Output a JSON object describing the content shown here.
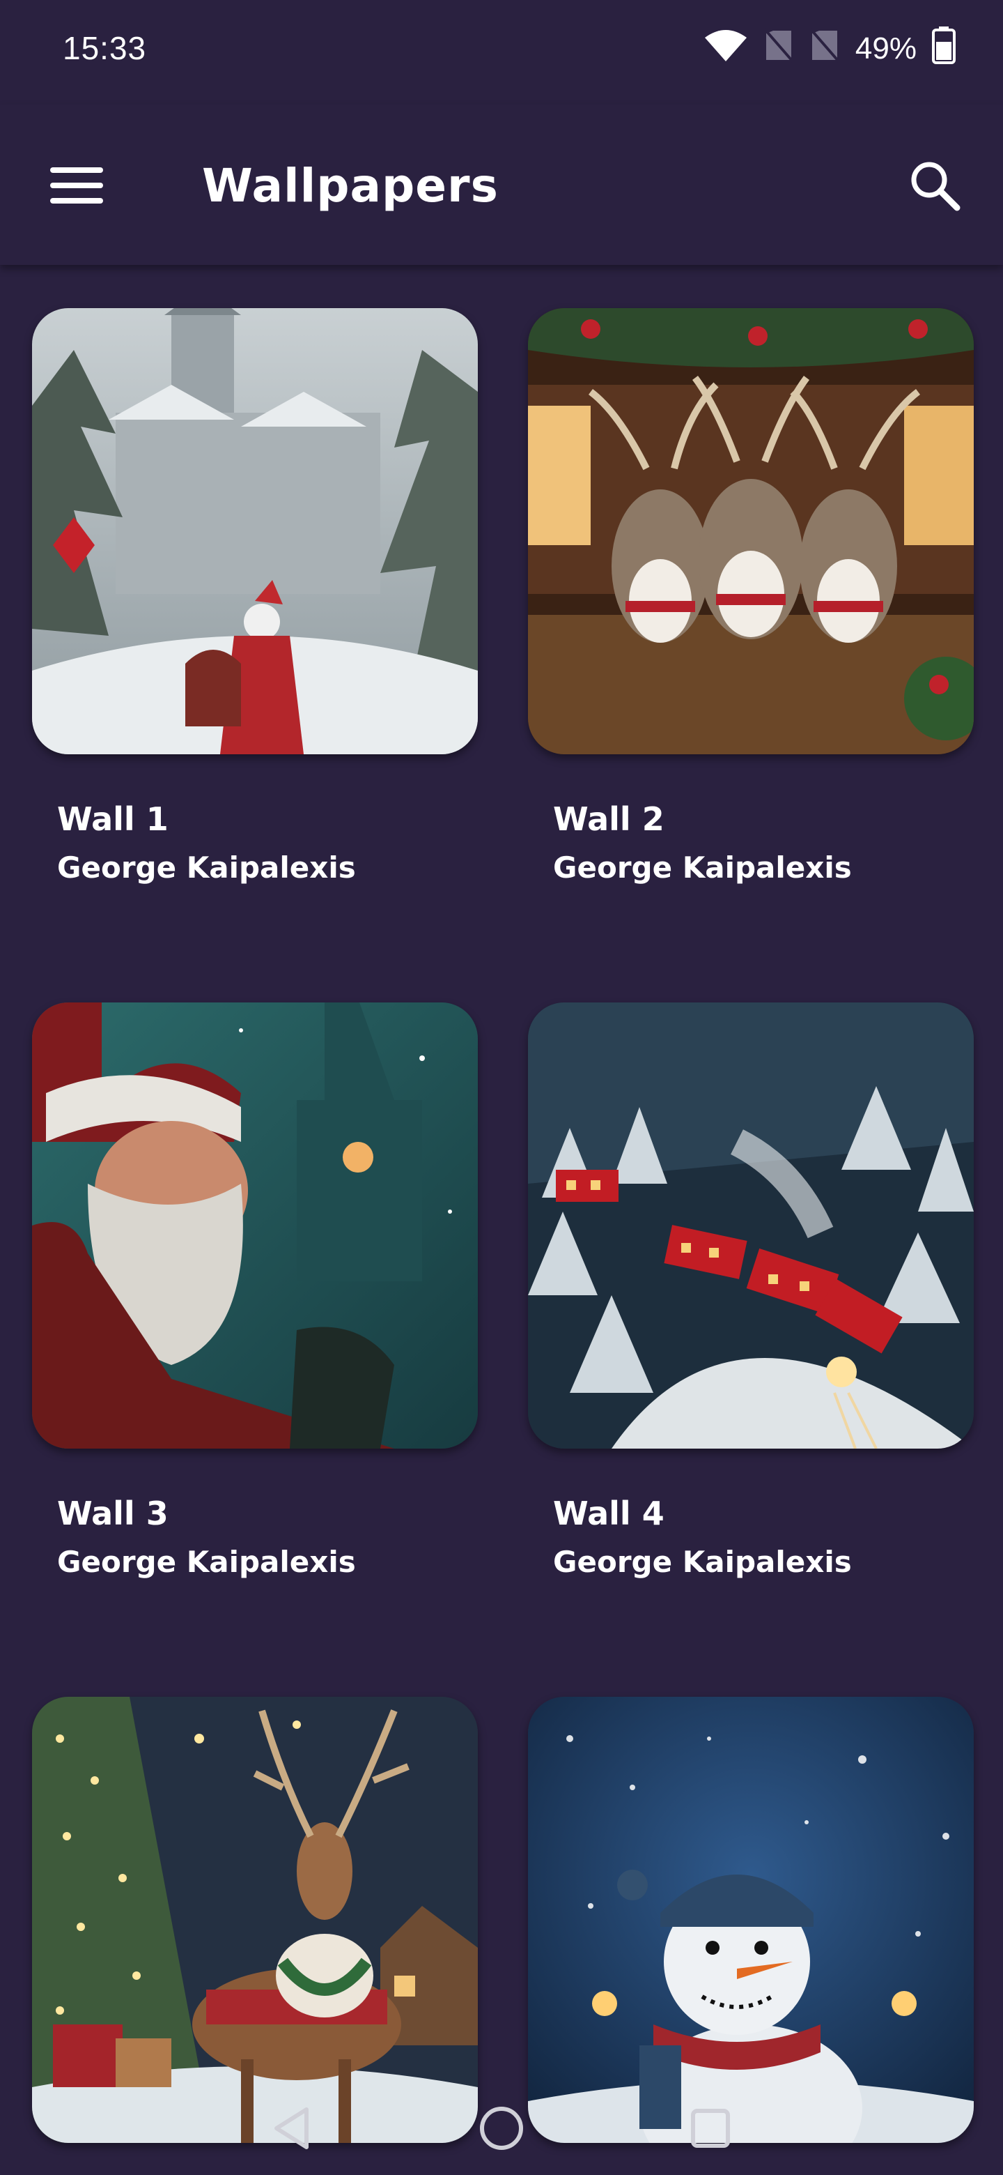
{
  "status_bar": {
    "time": "15:33",
    "battery": "49%"
  },
  "app_bar": {
    "title": "Wallpapers"
  },
  "wallpapers": [
    {
      "title": "Wall 1",
      "author": "George Kaipalexis",
      "icon": "santa-snowy-village-image"
    },
    {
      "title": "Wall 2",
      "author": "George Kaipalexis",
      "icon": "reindeer-cabin-image"
    },
    {
      "title": "Wall 3",
      "author": "George Kaipalexis",
      "icon": "santa-portrait-image"
    },
    {
      "title": "Wall 4",
      "author": "George Kaipalexis",
      "icon": "snow-train-image"
    },
    {
      "title": "",
      "author": "",
      "icon": "reindeer-christmas-tree-image"
    },
    {
      "title": "",
      "author": "",
      "icon": "snowman-night-image"
    }
  ],
  "colors": {
    "background": "#2a2140",
    "text": "#ffffff"
  }
}
